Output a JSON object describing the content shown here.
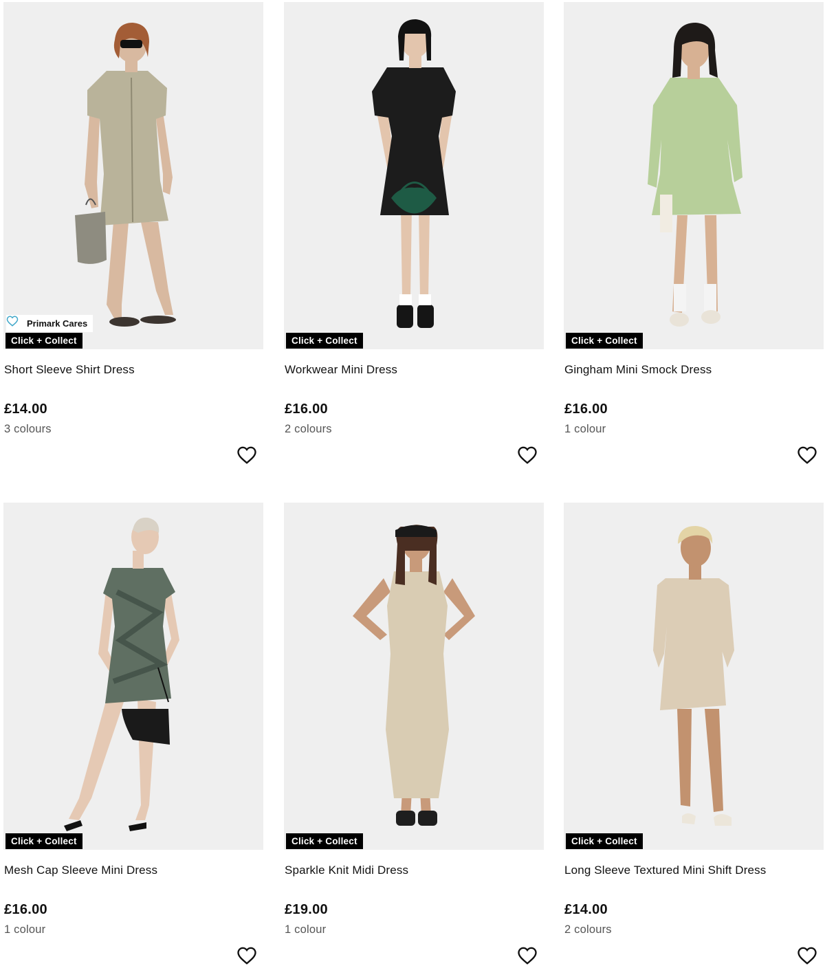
{
  "products": [
    {
      "name": "Short Sleeve Shirt Dress",
      "price": "£14.00",
      "colours": "3 colours",
      "badge": "Click + Collect",
      "tag": "Primark Cares",
      "dress_color": "#b9b39a",
      "image_alt": "Model wearing a khaki short sleeve shirt dress with sunglasses and a woven bucket bag"
    },
    {
      "name": "Workwear Mini Dress",
      "price": "£16.00",
      "colours": "2 colours",
      "badge": "Click + Collect",
      "dress_color": "#1c1c1c",
      "image_alt": "Model wearing a black workwear mini dress holding a green quilted bag"
    },
    {
      "name": "Gingham Mini Smock Dress",
      "price": "£16.00",
      "colours": "1 colour",
      "badge": "Click + Collect",
      "dress_color": "#b7cf9a",
      "image_alt": "Model wearing a green gingham mini smock dress"
    },
    {
      "name": "Mesh Cap Sleeve Mini Dress",
      "price": "£16.00",
      "colours": "1 colour",
      "badge": "Click + Collect",
      "dress_color": "#5f6f62",
      "image_alt": "Model wearing a green print mesh cap sleeve mini dress with a black bag"
    },
    {
      "name": "Sparkle Knit Midi Dress",
      "price": "£19.00",
      "colours": "1 colour",
      "badge": "Click + Collect",
      "dress_color": "#d9ccb3",
      "image_alt": "Model wearing a beige sparkle knit midi dress and a black visor"
    },
    {
      "name": "Long Sleeve Textured Mini Shift Dress",
      "price": "£14.00",
      "colours": "2 colours",
      "badge": "Click + Collect",
      "dress_color": "#dccdb6",
      "image_alt": "Model wearing a beige long sleeve textured mini shift dress"
    }
  ],
  "icons": {
    "wishlist": "heart-outline-icon",
    "cares": "heart-outline-icon"
  },
  "colors": {
    "badge_bg": "#000000",
    "image_bg": "#efefef",
    "cares_accent": "#3fa7c9"
  }
}
